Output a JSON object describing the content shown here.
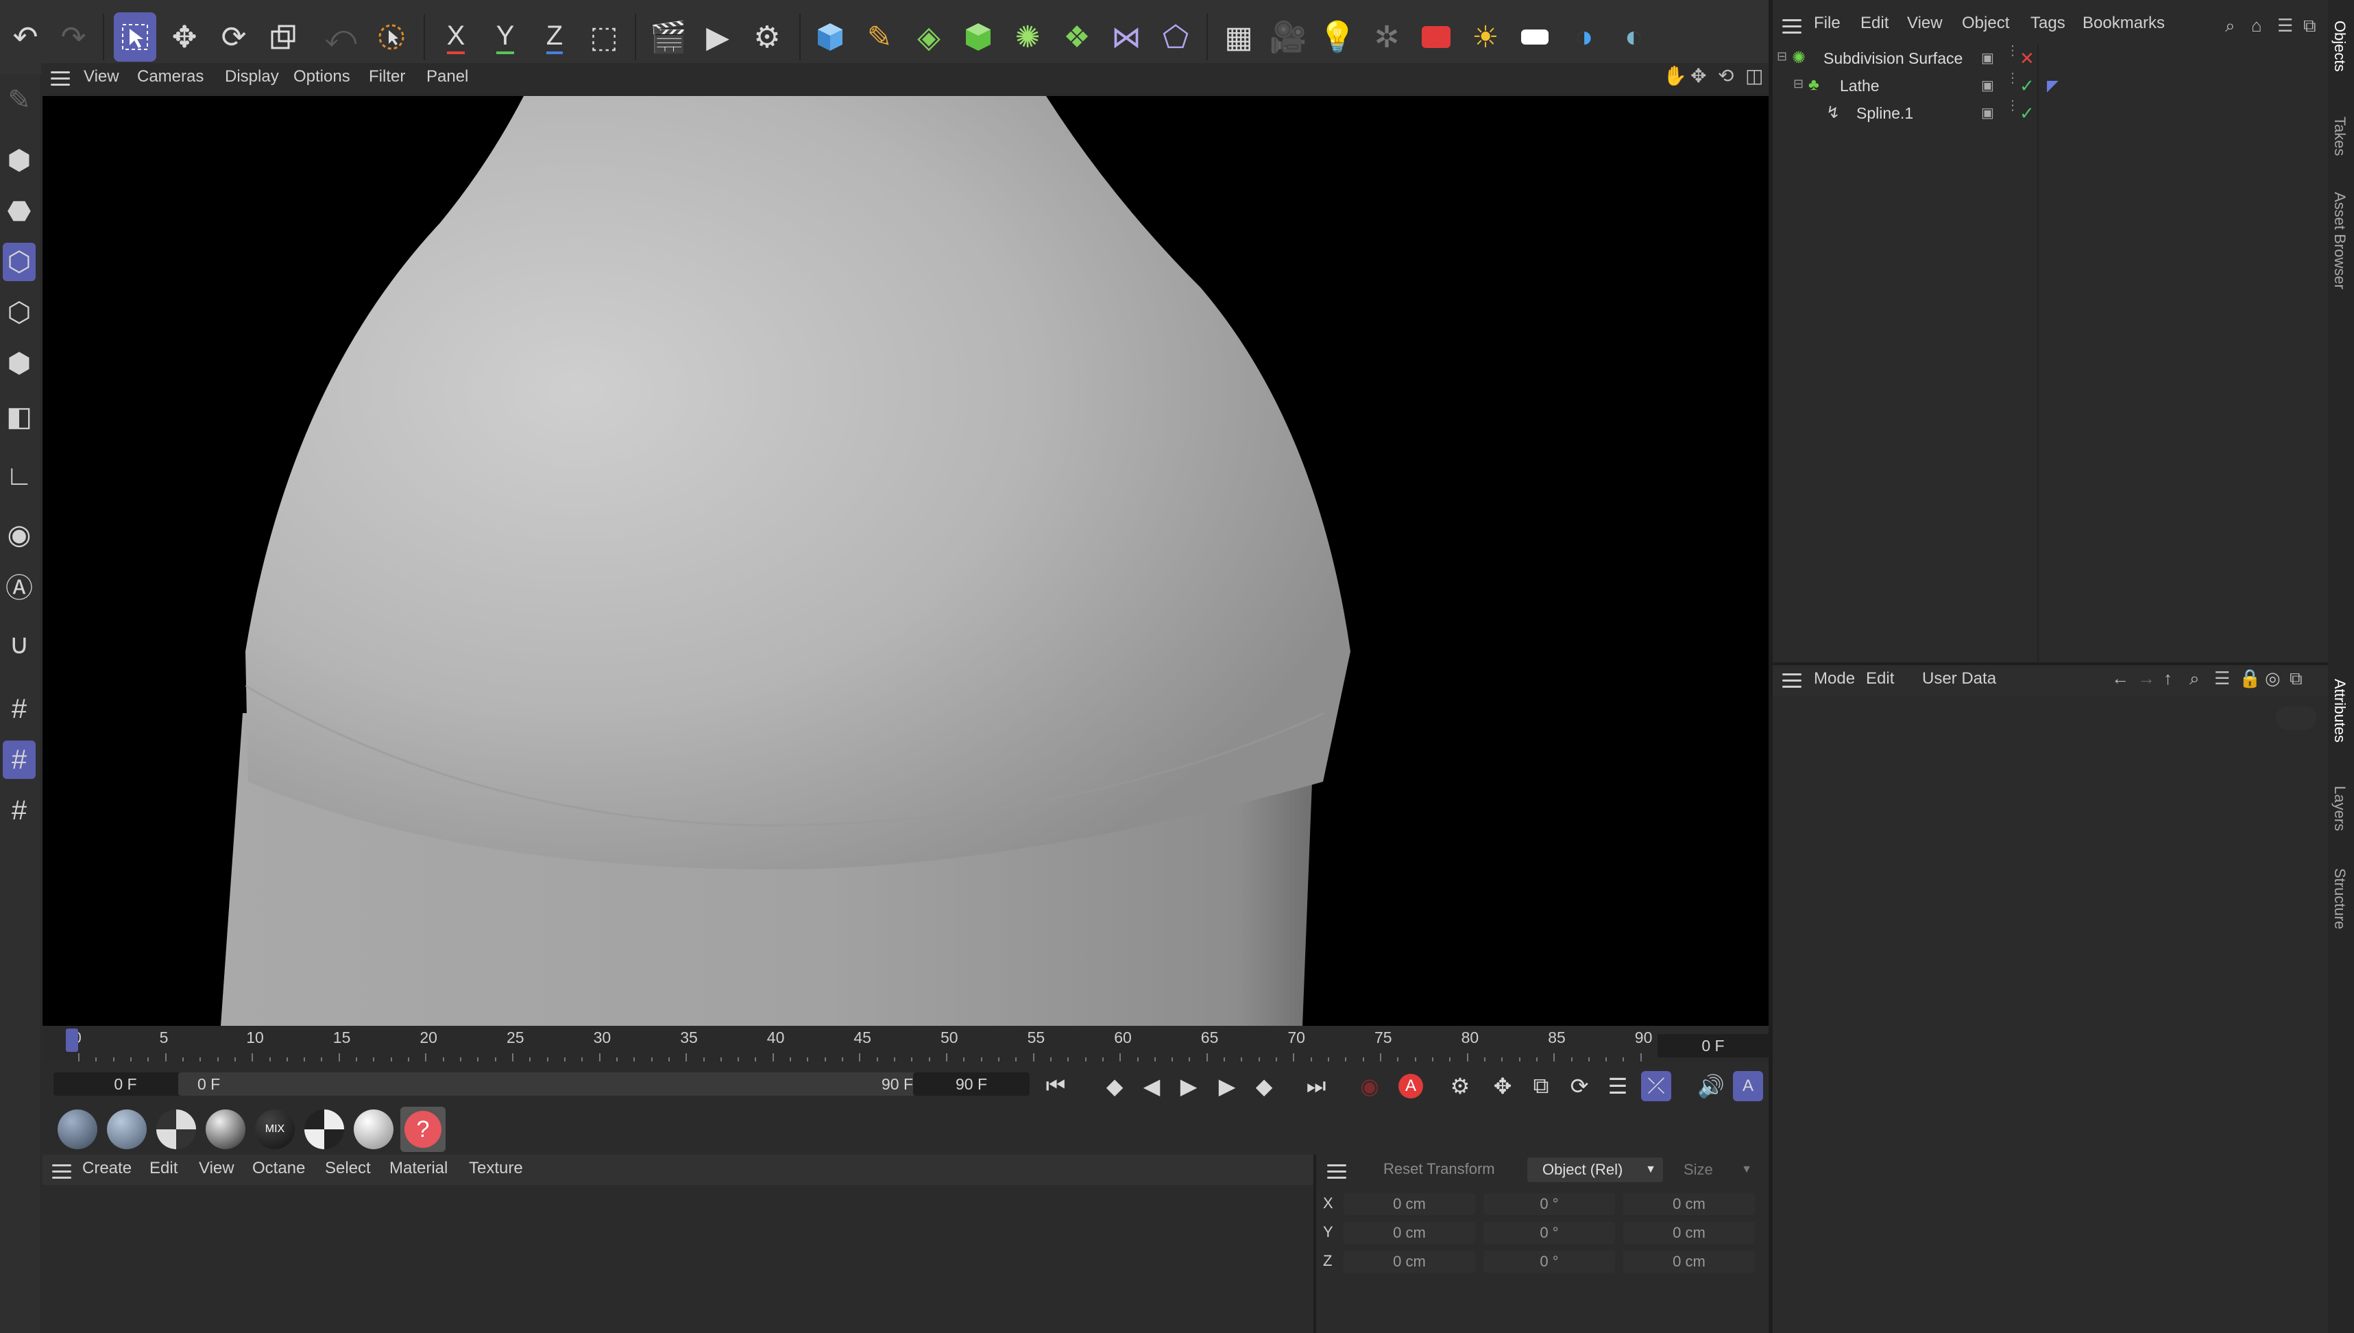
{
  "viewport_menu": [
    "View",
    "Cameras",
    "Display",
    "Options",
    "Filter",
    "Panel"
  ],
  "toolbar_axes": {
    "x": "X",
    "y": "Y",
    "z": "Z"
  },
  "objects_menu": [
    "File",
    "Edit",
    "View",
    "Object",
    "Tags",
    "Bookmarks"
  ],
  "objects": [
    {
      "name": "Subdivision Surface",
      "status": "x"
    },
    {
      "name": "Lathe",
      "status": "check"
    },
    {
      "name": "Spline.1",
      "status": "check"
    }
  ],
  "attr_menu": [
    "Mode",
    "Edit",
    "User Data"
  ],
  "side_tabs": [
    "Objects",
    "Takes",
    "Asset Browser",
    "Attributes",
    "Layers",
    "Structure"
  ],
  "timeline": {
    "ticks": [
      "0",
      "5",
      "10",
      "15",
      "20",
      "25",
      "30",
      "35",
      "40",
      "45",
      "50",
      "55",
      "60",
      "65",
      "70",
      "75",
      "80",
      "85",
      "90"
    ],
    "current_frame": "0 F",
    "start_frame": "0 F",
    "range_start": "0 F",
    "range_end": "90 F",
    "end_frame": "90 F"
  },
  "material_menu": [
    "Create",
    "Edit",
    "View",
    "Octane",
    "Select",
    "Material",
    "Texture"
  ],
  "material_mix_label": "MIX",
  "coords": {
    "reset_label": "Reset Transform",
    "mode": "Object (Rel)",
    "size_label": "Size",
    "rows": [
      {
        "axis": "X",
        "pos": "0 cm",
        "rot": "0 °",
        "size": "0 cm"
      },
      {
        "axis": "Y",
        "pos": "0 cm",
        "rot": "0 °",
        "size": "0 cm"
      },
      {
        "axis": "Z",
        "pos": "0 cm",
        "rot": "0 °",
        "size": "0 cm"
      }
    ]
  },
  "colors": {
    "accent": "#5a5fb0",
    "error_x": "#e0443e",
    "check": "#4fc26a"
  }
}
